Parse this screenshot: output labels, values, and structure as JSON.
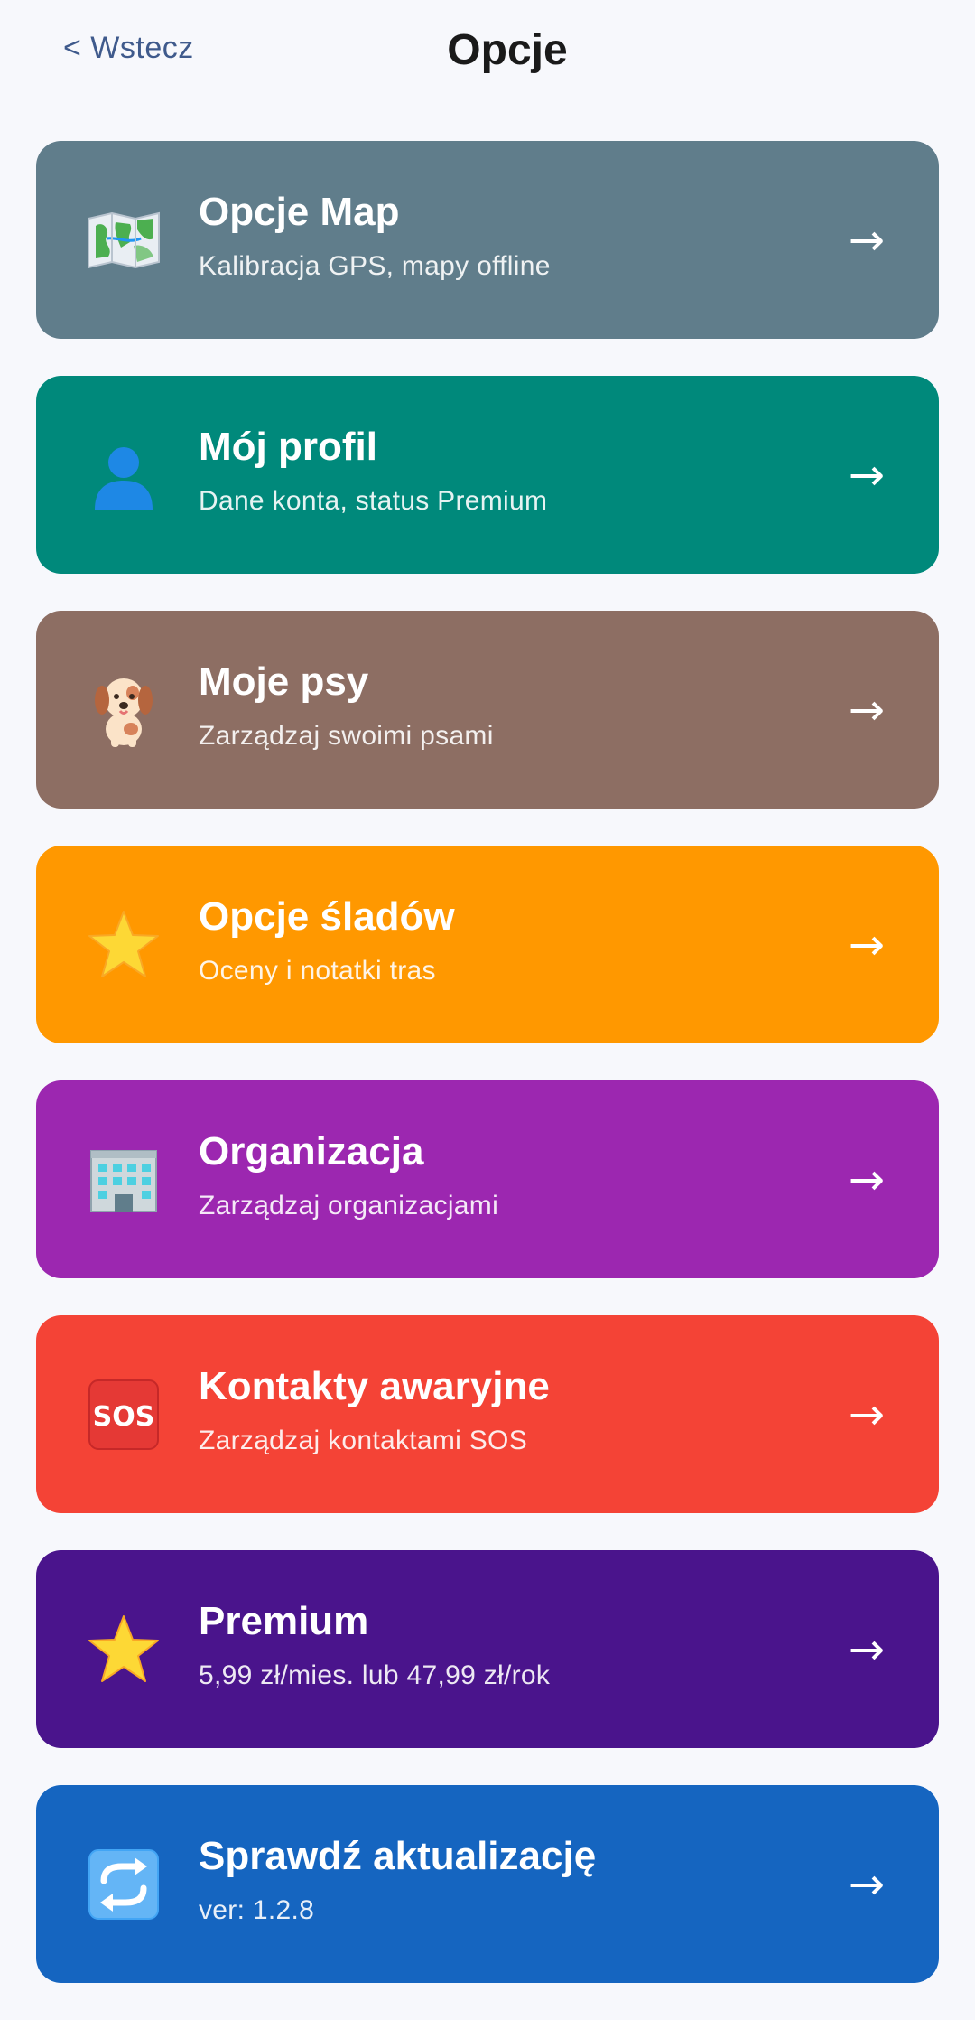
{
  "header": {
    "back_label": "< Wstecz",
    "title": "Opcje"
  },
  "menu": [
    {
      "title": "Opcje Map",
      "subtitle": "Kalibracja GPS, mapy offline",
      "icon": "map-icon",
      "color": "#607d8b",
      "arrow": "→"
    },
    {
      "title": "Mój profil",
      "subtitle": "Dane konta, status Premium",
      "icon": "user-icon",
      "color": "#00897b",
      "arrow": "→"
    },
    {
      "title": "Moje psy",
      "subtitle": "Zarządzaj swoimi psami",
      "icon": "dog-icon",
      "color": "#8d6e63",
      "arrow": "→"
    },
    {
      "title": "Opcje śladów",
      "subtitle": "Oceny i notatki tras",
      "icon": "star-icon",
      "color": "#ff9800",
      "arrow": "→"
    },
    {
      "title": "Organizacja",
      "subtitle": "Zarządzaj organizacjami",
      "icon": "office-building-icon",
      "color": "#9c27b0",
      "arrow": "→"
    },
    {
      "title": "Kontakty awaryjne",
      "subtitle": "Zarządzaj kontaktami SOS",
      "icon": "sos-icon",
      "color": "#f44336",
      "arrow": "→"
    },
    {
      "title": "Premium",
      "subtitle": "5,99 zł/mies. lub 47,99 zł/rok",
      "icon": "star-icon",
      "color": "#4a148c",
      "arrow": "→"
    },
    {
      "title": "Sprawdź aktualizację",
      "subtitle": "ver: 1.2.8",
      "icon": "refresh-icon",
      "color": "#1565c0",
      "arrow": "→"
    }
  ]
}
